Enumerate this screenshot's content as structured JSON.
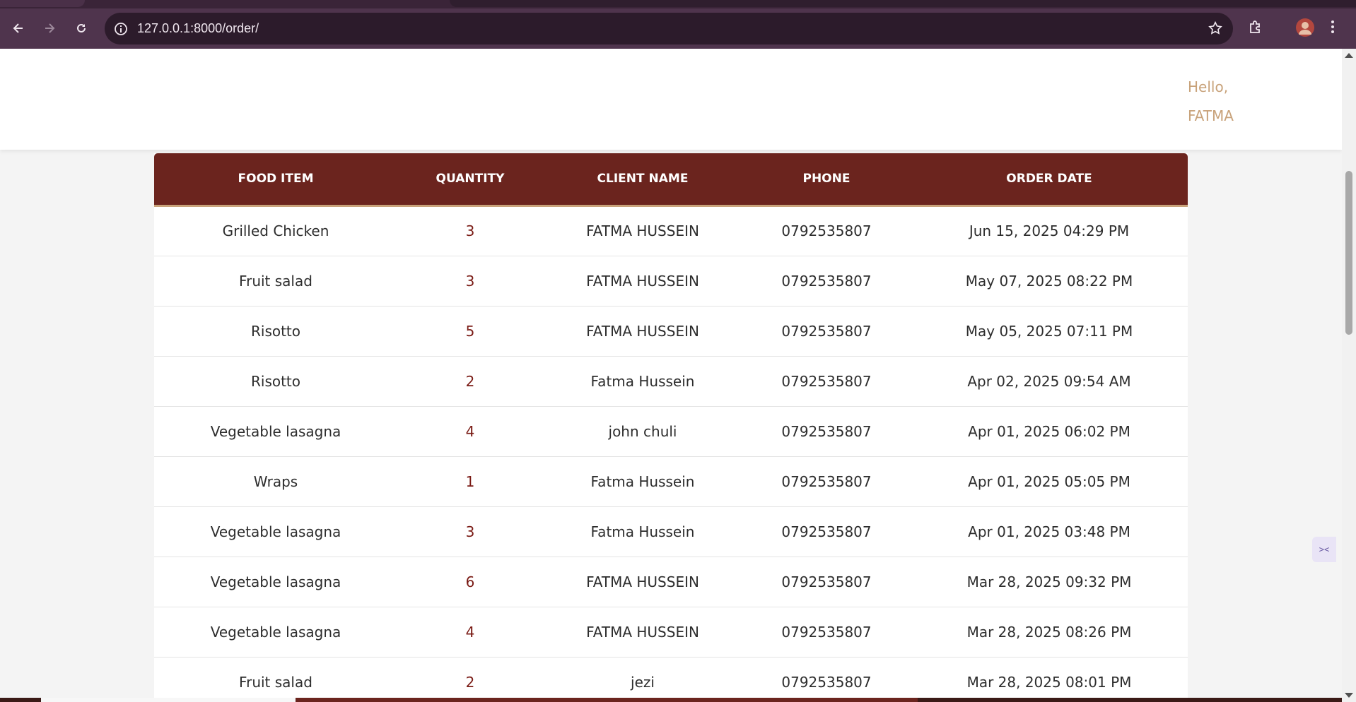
{
  "browser": {
    "url": "127.0.0.1:8000/order/",
    "icons": [
      "back-arrow-icon",
      "forward-arrow-icon",
      "reload-icon",
      "site-info-icon",
      "bookmark-star-icon",
      "extensions-puzzle-icon",
      "profile-avatar",
      "kebab-menu-icon"
    ]
  },
  "header": {
    "greeting_line1": "Hello,",
    "greeting_line2": "FATMA"
  },
  "orders": {
    "columns": [
      "FOOD ITEM",
      "QUANTITY",
      "CLIENT NAME",
      "PHONE",
      "ORDER DATE"
    ],
    "rows": [
      {
        "food": "Grilled Chicken",
        "qty": "3",
        "client": "FATMA HUSSEIN",
        "phone": "0792535807",
        "date": "Jun 15, 2025 04:29 PM"
      },
      {
        "food": "Fruit salad",
        "qty": "3",
        "client": "FATMA HUSSEIN",
        "phone": "0792535807",
        "date": "May 07, 2025 08:22 PM"
      },
      {
        "food": "Risotto",
        "qty": "5",
        "client": "FATMA HUSSEIN",
        "phone": "0792535807",
        "date": "May 05, 2025 07:11 PM"
      },
      {
        "food": "Risotto",
        "qty": "2",
        "client": "Fatma Hussein",
        "phone": "0792535807",
        "date": "Apr 02, 2025 09:54 AM"
      },
      {
        "food": "Vegetable lasagna",
        "qty": "4",
        "client": "john chuli",
        "phone": "0792535807",
        "date": "Apr 01, 2025 06:02 PM"
      },
      {
        "food": "Wraps",
        "qty": "1",
        "client": "Fatma Hussein",
        "phone": "0792535807",
        "date": "Apr 01, 2025 05:05 PM"
      },
      {
        "food": "Vegetable lasagna",
        "qty": "3",
        "client": "Fatma Hussein",
        "phone": "0792535807",
        "date": "Apr 01, 2025 03:48 PM"
      },
      {
        "food": "Vegetable lasagna",
        "qty": "6",
        "client": "FATMA HUSSEIN",
        "phone": "0792535807",
        "date": "Mar 28, 2025 09:32 PM"
      },
      {
        "food": "Vegetable lasagna",
        "qty": "4",
        "client": "FATMA HUSSEIN",
        "phone": "0792535807",
        "date": "Mar 28, 2025 08:26 PM"
      },
      {
        "food": "Fruit salad",
        "qty": "2",
        "client": "jezi",
        "phone": "0792535807",
        "date": "Mar 28, 2025 08:01 PM"
      }
    ]
  },
  "colors": {
    "header_bg": "#6b241e",
    "accent": "#c8a27a",
    "quantity_text": "#7a1b15"
  }
}
